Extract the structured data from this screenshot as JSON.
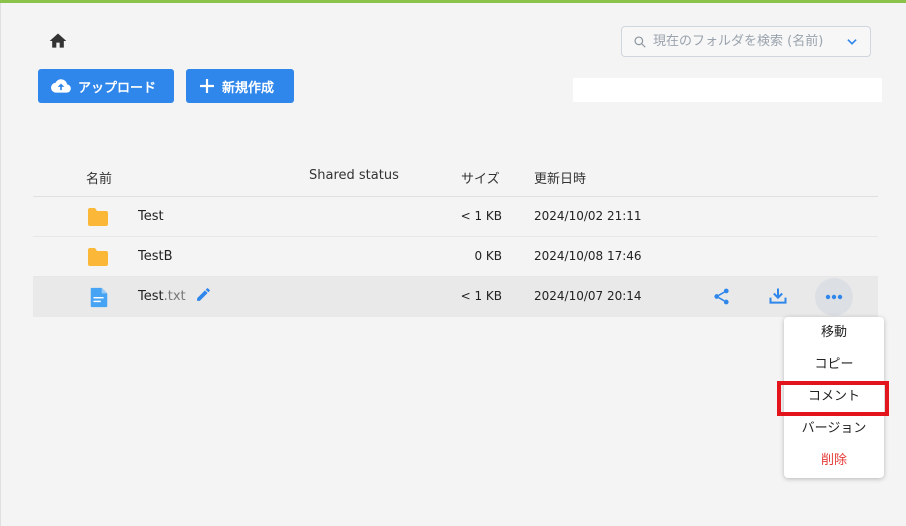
{
  "header": {
    "home_icon": "home-icon",
    "search": {
      "placeholder": "現在のフォルダを検索 (名前)",
      "icon": "search-icon",
      "dropdown_icon": "chevron-down-icon"
    }
  },
  "toolbar": {
    "upload_label": "アップロード",
    "upload_icon": "cloud-upload-icon",
    "new_label": "新規作成",
    "new_icon": "plus-icon"
  },
  "table": {
    "columns": {
      "name": "名前",
      "shared": "Shared status",
      "size": "サイズ",
      "date": "更新日時"
    },
    "rows": [
      {
        "type": "folder",
        "name": "Test",
        "ext": "",
        "size": "< 1 KB",
        "date": "2024/10/02 21:11"
      },
      {
        "type": "folder",
        "name": "TestB",
        "ext": "",
        "size": "0 KB",
        "date": "2024/10/08 17:46"
      },
      {
        "type": "file",
        "name": "Test",
        "ext": ".txt",
        "size": "< 1 KB",
        "date": "2024/10/07 20:14",
        "selected": true
      }
    ]
  },
  "context_menu": {
    "items": [
      "移動",
      "コピー",
      "コメント",
      "バージョン",
      "削除"
    ],
    "highlighted": "コメント"
  },
  "colors": {
    "accent_bar": "#8bc34a",
    "primary": "#2f86eb",
    "folder": "#fbb737",
    "file": "#47a3f3",
    "danger": "#e53935",
    "highlight": "#e3141c"
  }
}
